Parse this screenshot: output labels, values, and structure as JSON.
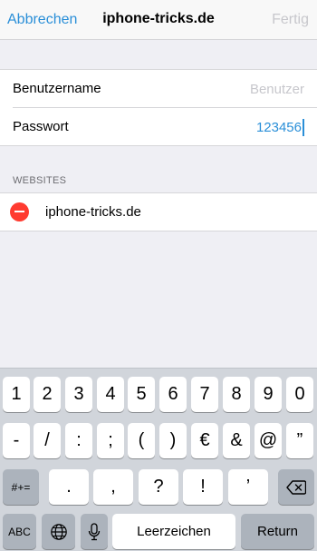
{
  "navbar": {
    "cancel_label": "Abbrechen",
    "title": "iphone-tricks.de",
    "done_label": "Fertig"
  },
  "form": {
    "username_label": "Benutzername",
    "username_placeholder": "Benutzer",
    "username_value": "",
    "password_label": "Passwort",
    "password_value": "123456"
  },
  "websites": {
    "header": "WEBSITES",
    "items": [
      {
        "label": "iphone-tricks.de"
      }
    ]
  },
  "keyboard": {
    "row1": [
      "1",
      "2",
      "3",
      "4",
      "5",
      "6",
      "7",
      "8",
      "9",
      "0"
    ],
    "row2": [
      "-",
      "/",
      ":",
      ";",
      "(",
      ")",
      "€",
      "&",
      "@",
      "”"
    ],
    "row3_switch": "#+=",
    "row3": [
      ".",
      ",",
      "?",
      "!",
      "’"
    ],
    "abc_label": "ABC",
    "space_label": "Leerzeichen",
    "return_label": "Return",
    "icons": [
      "delete-backspace-icon",
      "globe-icon",
      "microphone-icon"
    ]
  },
  "colors": {
    "accent": "#2a8fd8",
    "disabled": "#c7c7cc",
    "destructive": "#ff3b30",
    "background": "#efeff4",
    "keyboard_bg": "#d1d5db"
  }
}
